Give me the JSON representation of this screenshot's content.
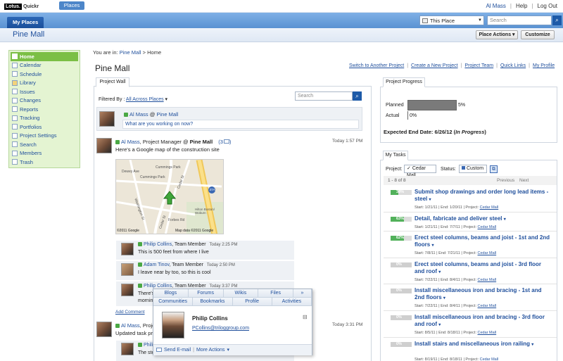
{
  "topbar": {
    "logo_brand": "Lotus.",
    "logo_product": "Quickr",
    "places_tab": "Places",
    "user": "Al Mass",
    "help": "Help",
    "logout": "Log Out",
    "sep": "|"
  },
  "nav": {
    "myplaces": "My Places",
    "scope": "This Place",
    "search_placeholder": "Search"
  },
  "place": {
    "title": "Pine Mall",
    "place_actions": "Place Actions",
    "customize": "Customize"
  },
  "sidebar": {
    "items": [
      {
        "label": "Home"
      },
      {
        "label": "Calendar"
      },
      {
        "label": "Schedule"
      },
      {
        "label": "Library"
      },
      {
        "label": "Issues"
      },
      {
        "label": "Changes"
      },
      {
        "label": "Reports"
      },
      {
        "label": "Tracking"
      },
      {
        "label": "Portfolios"
      },
      {
        "label": "Project Settings"
      },
      {
        "label": "Search"
      },
      {
        "label": "Members"
      },
      {
        "label": "Trash"
      }
    ]
  },
  "breadcrumb": {
    "prefix": "You are in:",
    "place": "Pine Mall",
    "arrow": ">",
    "current": "Home"
  },
  "main": {
    "title": "Pine Mall",
    "links": [
      "Switch to Another Project",
      "Create a New Project",
      "Project Team",
      "Quick Links",
      "My Profile"
    ]
  },
  "wall": {
    "tab": "Project Wall",
    "filter_label": "Filtered By :",
    "filter_value": "All Across Places",
    "search_placeholder": "Search",
    "status_author": "Al Mass",
    "status_at": "@",
    "status_place": "Pine Mall",
    "status_prompt": "What are you working on now?",
    "post": {
      "author": "Al Mass",
      "role": ", Project Manager @",
      "place": "Pine Mall",
      "count": "(3",
      "time": "Today 1:57 PM",
      "text": "Here's a Google map of the construction site"
    },
    "map": {
      "copyright_left": "©2011 Google",
      "copyright_right": "Map data ©2011 Google",
      "streets": [
        "Dewey Ave",
        "Cummings Park",
        "Cummings Park",
        "Washington St",
        "Cedar St",
        "Forbes Rd",
        "Cedar St",
        "Hilton Boston/ Woburn",
        "37A"
      ]
    },
    "comments": [
      {
        "author": "Philip Collins",
        "role": ", Team Member",
        "time": "Today 2:25 PM",
        "text": "This is 500 feet from where I live"
      },
      {
        "author": "Adam Tinov",
        "role": ", Team Member",
        "time": "Today 2:50 PM",
        "text": "I leave near by too, so this is cool"
      },
      {
        "author": "Philip Collins",
        "role": ", Team Member",
        "time": "Today 3:37 PM",
        "text": "There's",
        "text2": "mornin"
      }
    ],
    "add_comment": "Add Comment",
    "post2": {
      "author": "Al Mass",
      "role": ", Projec",
      "time": "Today 3:31 PM",
      "text": "Updated task pro",
      "author2": "Philip Collins",
      "text2": "The ste"
    }
  },
  "hovercard": {
    "row1": [
      "Blogs",
      "Forums",
      "Wikis",
      "Files",
      "»"
    ],
    "row2": [
      "Communities",
      "Bookmarks",
      "Profile",
      "Activities"
    ],
    "name": "Philip Collins",
    "email": "PCollins@triloggroup.com",
    "send_email": "Send E-mail",
    "more_actions": "More Actions",
    "collapse": "⊟"
  },
  "progress": {
    "tab": "Project Progress",
    "planned_label": "Planned",
    "planned_pct": "5%",
    "actual_label": "Actual",
    "actual_pct": "0%",
    "planned_value": 0.05,
    "actual_value": 0.0,
    "expected_label": "Expected End Date: 6/26/12 (",
    "expected_status": "In Progress",
    "expected_close": ")"
  },
  "tasks": {
    "tab": "My Tasks",
    "project_label": "Project:",
    "project_value": "Cedar Mall",
    "status_label": "Status:",
    "status_value": "Custom",
    "range": "1 - 8 of 8",
    "previous": "Previous",
    "next": "Next",
    "items": [
      {
        "pct": "38%",
        "value": 0.38,
        "title": "Submit shop drawings and order long lead items - steel",
        "start": "Start: 1/21/11",
        "end": "End: 1/20/11",
        "project": "Cedar Mall"
      },
      {
        "pct": "63%",
        "value": 0.63,
        "title": "Detail, fabricate and deliver steel",
        "start": "Start: 1/21/11",
        "end": "End: 7/7/11",
        "project": "Cedar Mall"
      },
      {
        "pct": "62%",
        "value": 0.62,
        "title": "Erect steel columns, beams and joist - 1st and 2nd floors",
        "start": "Start: 7/8/11",
        "end": "End: 7/21/11",
        "project": "Cedar Mall"
      },
      {
        "pct": "0%",
        "value": 0.0,
        "title": "Erect steel columns, beams and joist - 3rd floor and roof",
        "start": "Start: 7/22/11",
        "end": "End: 8/4/11",
        "project": "Cedar Mall"
      },
      {
        "pct": "0%",
        "value": 0.0,
        "title": "Install miscellaneous iron and bracing - 1st and 2nd floors",
        "start": "Start: 7/22/11",
        "end": "End: 8/4/11",
        "project": "Cedar Mall"
      },
      {
        "pct": "0%",
        "value": 0.0,
        "title": "Install miscellaneous iron and bracing - 3rd floor and roof",
        "start": "Start: 8/5/11",
        "end": "End: 8/18/11",
        "project": "Cedar Mall"
      },
      {
        "pct": "0%",
        "value": 0.0,
        "title": "Install stairs and miscellaneous iron railing",
        "start": "Start: 8/19/11",
        "end": "End: 8/18/11",
        "project": "Cedar Mall"
      }
    ]
  },
  "colors": {
    "accent": "#1f4f9c",
    "nav_active": "#7bbf45",
    "progress": "#52b15b"
  }
}
